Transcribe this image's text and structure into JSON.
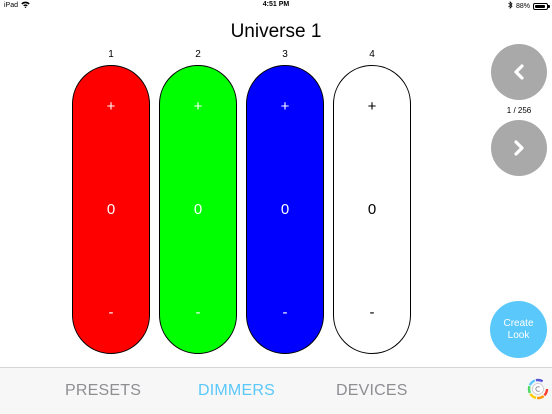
{
  "status_bar": {
    "device": "iPad",
    "time": "4:51 PM",
    "battery": "88%",
    "battery_level": 0.88
  },
  "title": "Universe 1",
  "faders": [
    {
      "number": "1",
      "plus": "+",
      "value": "0",
      "minus": "-",
      "color": "#ff0000",
      "text_color": "#ffffff"
    },
    {
      "number": "2",
      "plus": "+",
      "value": "0",
      "minus": "-",
      "color": "#00ff00",
      "text_color": "#ffffff"
    },
    {
      "number": "3",
      "plus": "+",
      "value": "0",
      "minus": "-",
      "color": "#0000ff",
      "text_color": "#ffffff"
    },
    {
      "number": "4",
      "plus": "+",
      "value": "0",
      "minus": "-",
      "color": "#ffffff",
      "text_color": "#000000"
    }
  ],
  "pagination": {
    "label": "1 / 256",
    "prev_icon": "chevron-left-icon",
    "next_icon": "chevron-right-icon"
  },
  "create_look": {
    "label": "Create Look",
    "color": "#5ac8fa"
  },
  "tabs": [
    {
      "label": "PRESETS",
      "active": false
    },
    {
      "label": "DIMMERS",
      "active": true
    },
    {
      "label": "DEVICES",
      "active": false
    }
  ],
  "colors": {
    "accent": "#5ac8fa",
    "inactive_tab": "#8e8e93",
    "nav_button": "#a9a9a9"
  }
}
